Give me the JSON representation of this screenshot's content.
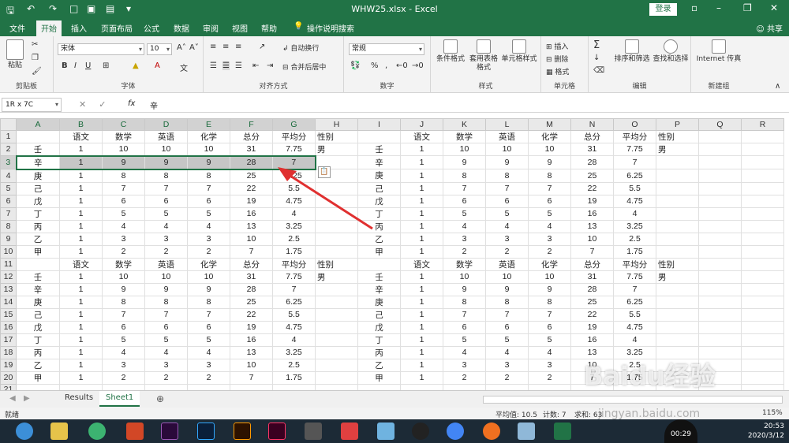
{
  "title": "WHW25.xlsx - Excel",
  "login": "登录",
  "share": "共享",
  "tabs": [
    "文件",
    "开始",
    "插入",
    "页面布局",
    "公式",
    "数据",
    "审阅",
    "视图",
    "帮助",
    "操作说明搜索"
  ],
  "ribbon": {
    "paste": "粘贴",
    "clipboard": "剪贴板",
    "font_name": "宋体",
    "font_size": "10",
    "font": "字体",
    "wrap": "自动换行",
    "merge": "合并后居中",
    "align": "对齐方式",
    "num_format": "常规",
    "number": "数字",
    "cond_format": "条件格式",
    "table_format": "套用表格格式",
    "cell_style": "单元格样式",
    "styles": "样式",
    "insert": "插入",
    "delete": "删除",
    "format": "格式",
    "cells": "单元格",
    "sort": "排序和筛选",
    "find": "查找和选择",
    "editing": "编辑",
    "ie": "Internet 传真",
    "newgroup": "新建组"
  },
  "formula": {
    "namebox": "1R x 7C",
    "fx": "fx",
    "value": "辛"
  },
  "columns": [
    "A",
    "B",
    "C",
    "D",
    "E",
    "F",
    "G",
    "H",
    "I",
    "J",
    "K",
    "L",
    "M",
    "N",
    "O",
    "P",
    "Q",
    "R"
  ],
  "rows": [
    [
      "",
      "语文",
      "数学",
      "英语",
      "化学",
      "总分",
      "平均分",
      "性别",
      "",
      "语文",
      "数学",
      "英语",
      "化学",
      "总分",
      "平均分",
      "性别",
      "",
      ""
    ],
    [
      "壬",
      "1",
      "10",
      "10",
      "10",
      "31",
      "7.75",
      "男",
      "壬",
      "1",
      "10",
      "10",
      "10",
      "31",
      "7.75",
      "男",
      "",
      ""
    ],
    [
      "辛",
      "1",
      "9",
      "9",
      "9",
      "28",
      "7",
      "",
      "辛",
      "1",
      "9",
      "9",
      "9",
      "28",
      "7",
      "",
      "",
      ""
    ],
    [
      "庚",
      "1",
      "8",
      "8",
      "8",
      "25",
      "6.25",
      "",
      "庚",
      "1",
      "8",
      "8",
      "8",
      "25",
      "6.25",
      "",
      "",
      ""
    ],
    [
      "己",
      "1",
      "7",
      "7",
      "7",
      "22",
      "5.5",
      "",
      "己",
      "1",
      "7",
      "7",
      "7",
      "22",
      "5.5",
      "",
      "",
      ""
    ],
    [
      "戊",
      "1",
      "6",
      "6",
      "6",
      "19",
      "4.75",
      "",
      "戊",
      "1",
      "6",
      "6",
      "6",
      "19",
      "4.75",
      "",
      "",
      ""
    ],
    [
      "丁",
      "1",
      "5",
      "5",
      "5",
      "16",
      "4",
      "",
      "丁",
      "1",
      "5",
      "5",
      "5",
      "16",
      "4",
      "",
      "",
      ""
    ],
    [
      "丙",
      "1",
      "4",
      "4",
      "4",
      "13",
      "3.25",
      "",
      "丙",
      "1",
      "4",
      "4",
      "4",
      "13",
      "3.25",
      "",
      "",
      ""
    ],
    [
      "乙",
      "1",
      "3",
      "3",
      "3",
      "10",
      "2.5",
      "",
      "乙",
      "1",
      "3",
      "3",
      "3",
      "10",
      "2.5",
      "",
      "",
      ""
    ],
    [
      "甲",
      "1",
      "2",
      "2",
      "2",
      "7",
      "1.75",
      "",
      "甲",
      "1",
      "2",
      "2",
      "2",
      "7",
      "1.75",
      "",
      "",
      ""
    ],
    [
      "",
      "语文",
      "数学",
      "英语",
      "化学",
      "总分",
      "平均分",
      "性别",
      "",
      "语文",
      "数学",
      "英语",
      "化学",
      "总分",
      "平均分",
      "性别",
      "",
      ""
    ],
    [
      "壬",
      "1",
      "10",
      "10",
      "10",
      "31",
      "7.75",
      "男",
      "壬",
      "1",
      "10",
      "10",
      "10",
      "31",
      "7.75",
      "男",
      "",
      ""
    ],
    [
      "辛",
      "1",
      "9",
      "9",
      "9",
      "28",
      "7",
      "",
      "辛",
      "1",
      "9",
      "9",
      "9",
      "28",
      "7",
      "",
      "",
      ""
    ],
    [
      "庚",
      "1",
      "8",
      "8",
      "8",
      "25",
      "6.25",
      "",
      "庚",
      "1",
      "8",
      "8",
      "8",
      "25",
      "6.25",
      "",
      "",
      ""
    ],
    [
      "己",
      "1",
      "7",
      "7",
      "7",
      "22",
      "5.5",
      "",
      "己",
      "1",
      "7",
      "7",
      "7",
      "22",
      "5.5",
      "",
      "",
      ""
    ],
    [
      "戊",
      "1",
      "6",
      "6",
      "6",
      "19",
      "4.75",
      "",
      "戊",
      "1",
      "6",
      "6",
      "6",
      "19",
      "4.75",
      "",
      "",
      ""
    ],
    [
      "丁",
      "1",
      "5",
      "5",
      "5",
      "16",
      "4",
      "",
      "丁",
      "1",
      "5",
      "5",
      "5",
      "16",
      "4",
      "",
      "",
      ""
    ],
    [
      "丙",
      "1",
      "4",
      "4",
      "4",
      "13",
      "3.25",
      "",
      "丙",
      "1",
      "4",
      "4",
      "4",
      "13",
      "3.25",
      "",
      "",
      ""
    ],
    [
      "乙",
      "1",
      "3",
      "3",
      "3",
      "10",
      "2.5",
      "",
      "乙",
      "1",
      "3",
      "3",
      "3",
      "10",
      "2.5",
      "",
      "",
      ""
    ],
    [
      "甲",
      "1",
      "2",
      "2",
      "2",
      "7",
      "1.75",
      "",
      "甲",
      "1",
      "2",
      "2",
      "2",
      "7",
      "1.75",
      "",
      "",
      ""
    ],
    [
      "",
      "",
      "",
      "",
      "",
      "",
      "",
      "",
      "",
      "",
      "",
      "",
      "",
      "",
      "",
      "",
      "",
      ""
    ],
    [
      "",
      "",
      "",
      "",
      "",
      "",
      "",
      "",
      "",
      "",
      "",
      "",
      "",
      "",
      "",
      "",
      "",
      ""
    ],
    [
      "",
      "",
      "",
      "",
      "",
      "",
      "",
      "",
      "",
      "",
      "",
      "",
      "",
      "",
      "",
      "",
      "",
      ""
    ]
  ],
  "selected_row": 3,
  "sheets": [
    "Results",
    "Sheet1"
  ],
  "active_sheet": "Sheet1",
  "status": {
    "ready": "就绪",
    "avg": "平均值: 10.5",
    "count": "计数: 7",
    "sum": "求和: 63",
    "zoom": "115%"
  },
  "clock": {
    "time": "20:53",
    "date": "2020/3/12"
  },
  "video_time": "00:29",
  "watermark": "Baidu经验",
  "watermark_url": "jingyan.baidu.com"
}
